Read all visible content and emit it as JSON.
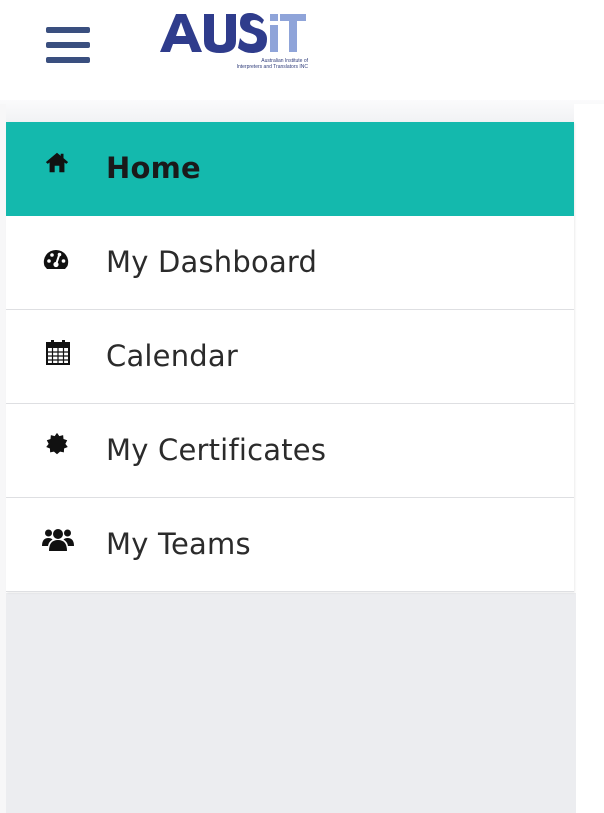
{
  "header": {
    "menu_icon": "hamburger-menu-icon",
    "logo": {
      "text": "AUSIT",
      "tagline_line1": "Australian Institute of",
      "tagline_line2": "Interpreters and Translators INC"
    }
  },
  "nav": {
    "active_color": "#14b9ad",
    "items": [
      {
        "label": "Home",
        "icon": "home-icon",
        "active": true
      },
      {
        "label": "My Dashboard",
        "icon": "dashboard-gauge-icon",
        "active": false
      },
      {
        "label": "Calendar",
        "icon": "calendar-icon",
        "active": false
      },
      {
        "label": "My Certificates",
        "icon": "certificate-badge-icon",
        "active": false
      },
      {
        "label": "My Teams",
        "icon": "team-users-icon",
        "active": false
      }
    ]
  }
}
